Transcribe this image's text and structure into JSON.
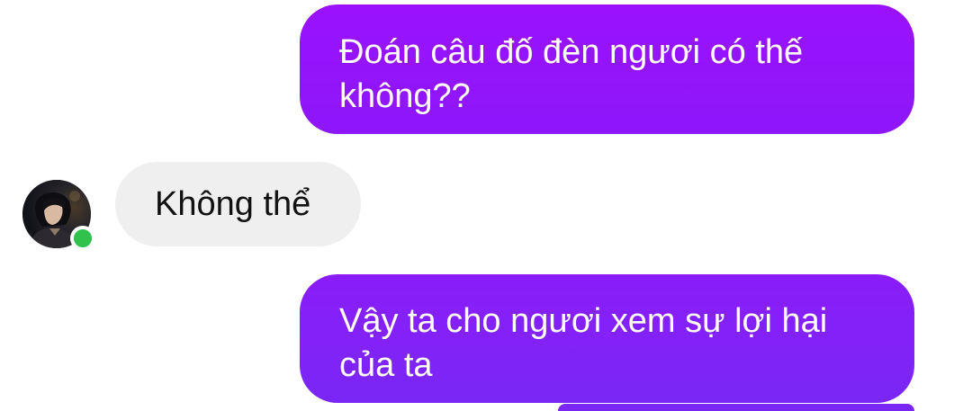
{
  "messages": [
    {
      "direction": "sent",
      "text": "Đoán câu đố đèn ngươi có thế không??"
    },
    {
      "direction": "received",
      "text": "Không thể"
    },
    {
      "direction": "sent",
      "text": "Vậy ta cho ngươi xem sự lợi hại của ta"
    }
  ],
  "contact": {
    "online": true,
    "presence_color": "#31c24d"
  },
  "colors": {
    "sent_bubble": "#8e17fa",
    "sent_bubble_bottom": "#7a27f6",
    "received_bubble": "#efefef",
    "sent_text": "#ffffff",
    "received_text": "#111111"
  }
}
